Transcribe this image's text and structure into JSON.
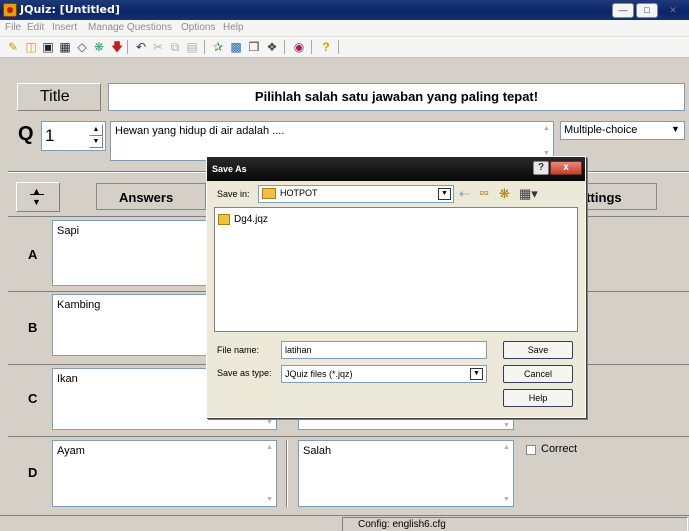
{
  "window": {
    "title": "JQuiz: [Untitled]",
    "icon": "hot-potatoes-app-icon"
  },
  "menu": [
    "File",
    "Edit",
    "Insert",
    "Manage Questions",
    "Options",
    "Help"
  ],
  "toolbar_icons": [
    "new-file-icon",
    "open-folder-icon",
    "save-icon",
    "save-as-icon",
    "clear-icon",
    "export-web-icon",
    "download-arrow-icon",
    "undo-icon",
    "cut-icon",
    "copy-icon",
    "paste-icon",
    "add-text-icon",
    "insert-picture-icon",
    "insert-link-icon",
    "insert-media-icon",
    "config-icon",
    "help-icon"
  ],
  "title_row": {
    "label": "Title",
    "value": "Pilihlah salah satu jawaban yang paling tepat!"
  },
  "question_row": {
    "label": "Q",
    "number": "1",
    "text": "Hewan yang hidup di air adalah ....",
    "type": "Multiple-choice"
  },
  "answers_header": {
    "answers_label": "Answers",
    "settings_label": "ettings"
  },
  "answers": [
    {
      "letter": "A",
      "text": "Sapi"
    },
    {
      "letter": "B",
      "text": "Kambing"
    },
    {
      "letter": "C",
      "text": "Ikan"
    },
    {
      "letter": "D",
      "text": "Ayam",
      "feedback": "Salah",
      "correct_label": "Correct"
    }
  ],
  "status_bar": {
    "config": "Config: english6.cfg"
  },
  "dialog": {
    "title": "Save As",
    "save_in_label": "Save in:",
    "save_in_value": "HOTPOT",
    "files": [
      {
        "name": "Dg4.jqz"
      }
    ],
    "file_name_label": "File name:",
    "file_name_value": "latihan",
    "save_type_label": "Save as type:",
    "save_type_value": "JQuiz files (*.jqz)",
    "save_button": "Save",
    "cancel_button": "Cancel",
    "help_button": "Help",
    "help_glyph": "?",
    "close_glyph": "x"
  }
}
